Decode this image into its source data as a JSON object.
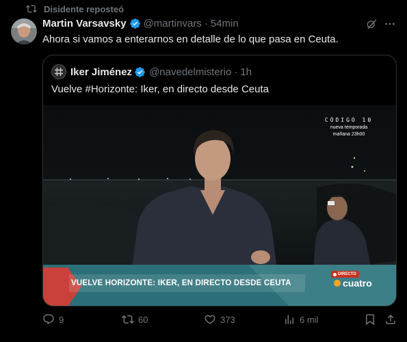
{
  "repost": {
    "text": "Disidente reposteó",
    "icon": "repost-icon"
  },
  "tweet": {
    "author_name": "Martin Varsavsky",
    "handle": "@martinvars",
    "separator": "·",
    "time": "54min",
    "text": "Ahora si vamos a enterarnos en detalle de lo que pasa en Ceuta.",
    "verified_color": "#1d9bf0"
  },
  "quote": {
    "author_name": "Iker Jiménez",
    "handle": "@navedelmisterio",
    "separator": "·",
    "time": "1h",
    "text": "Vuelve #Horizonte: Iker, en directo desde Ceuta",
    "video": {
      "show_logo": "CÓDIGO 10",
      "promo_line1": "nueva temporada",
      "promo_line2": "mañana 23h00",
      "headline": "VUELVE HORIZONTE: IKER, EN DIRECTO DESDE CEUTA",
      "live_badge": "DIRECTO",
      "channel": "cuatro",
      "lower_third_colors": [
        "#2b6f78",
        "#c9413a",
        "#ffffff"
      ]
    }
  },
  "actions": {
    "replies": "9",
    "reposts": "60",
    "likes": "373",
    "views": "6 mil"
  },
  "colors": {
    "background": "#000000",
    "text": "#e7e9ea",
    "muted": "#71767b",
    "border": "#2f3336",
    "accent": "#1d9bf0"
  }
}
